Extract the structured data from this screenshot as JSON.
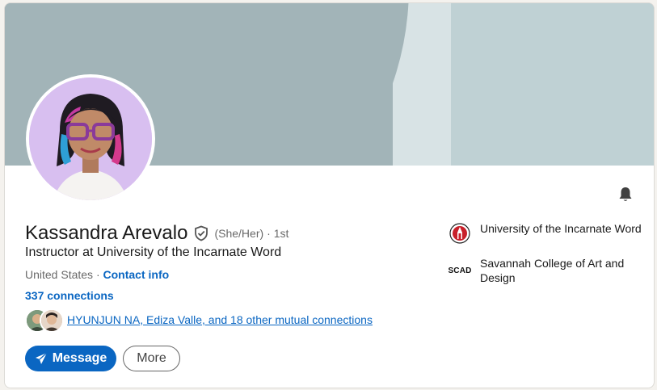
{
  "profile": {
    "name": "Kassandra Arevalo",
    "pronouns": "(She/Her)",
    "degree": "· 1st",
    "headline": "Instructor at University of the Incarnate Word",
    "location": "United States ·",
    "contact_info": "Contact info",
    "connections": "337 connections",
    "mutual": {
      "name1": "HYUNJUN NA",
      "name2": "Ediza Valle",
      "rest": ", and 18 other mutual connections"
    }
  },
  "actions": {
    "message": "Message",
    "more": "More"
  },
  "education": [
    {
      "label": "University of the Incarnate Word",
      "icon": "uiw-seal-icon"
    },
    {
      "label": "Savannah College of Art and Design",
      "logo_text": "SCAD"
    }
  ],
  "colors": {
    "accent": "#0a66c2",
    "banner_dark": "#a2b4b8",
    "banner_light": "#bfd1d4"
  }
}
